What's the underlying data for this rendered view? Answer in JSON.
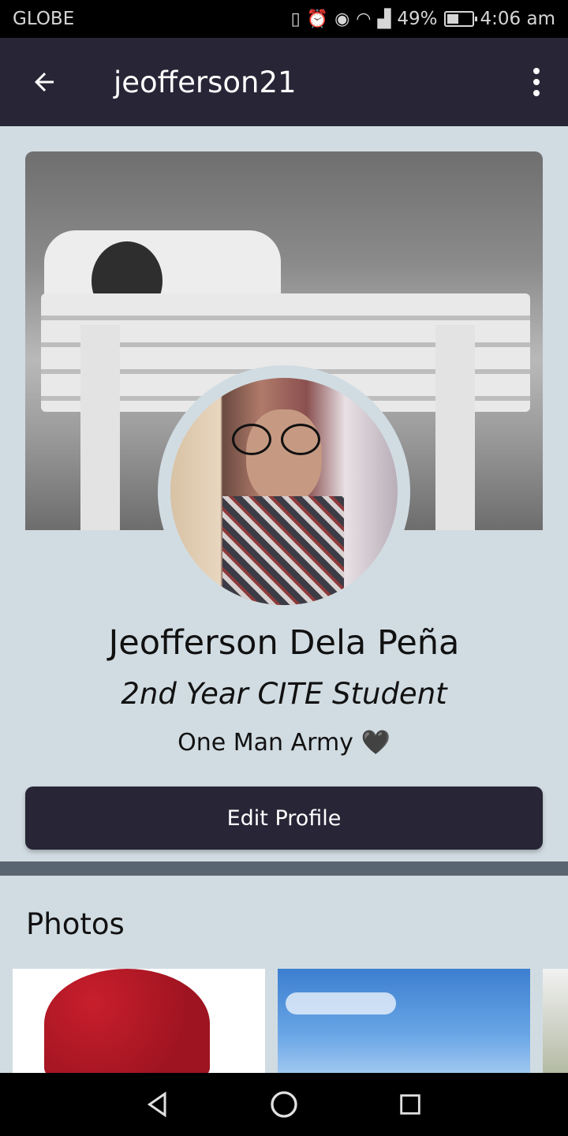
{
  "status_bar": {
    "carrier": "GLOBE",
    "battery_percent": "49%",
    "battery_level": 0.49,
    "time": "4:06 am",
    "icons": [
      "vibrate-icon",
      "alarm-icon",
      "eye-icon",
      "wifi-icon",
      "signal-icon",
      "battery-icon"
    ]
  },
  "app_bar": {
    "title": "jeofferson21",
    "back_icon": "arrow-left-icon",
    "menu_icon": "more-vert-icon"
  },
  "profile": {
    "name": "Jeofferson Dela Peña",
    "subtitle": "2nd Year CITE Student",
    "bio": "One Man Army 🖤",
    "edit_button": "Edit Profile"
  },
  "photos_section": {
    "title": "Photos"
  },
  "nav_bar": {
    "buttons": [
      "back-triangle-icon",
      "home-circle-icon",
      "recents-square-icon"
    ]
  },
  "colors": {
    "app_bar_bg": "#272536",
    "page_bg": "#d1dce2",
    "button_bg": "#272536",
    "divider": "#596571"
  }
}
